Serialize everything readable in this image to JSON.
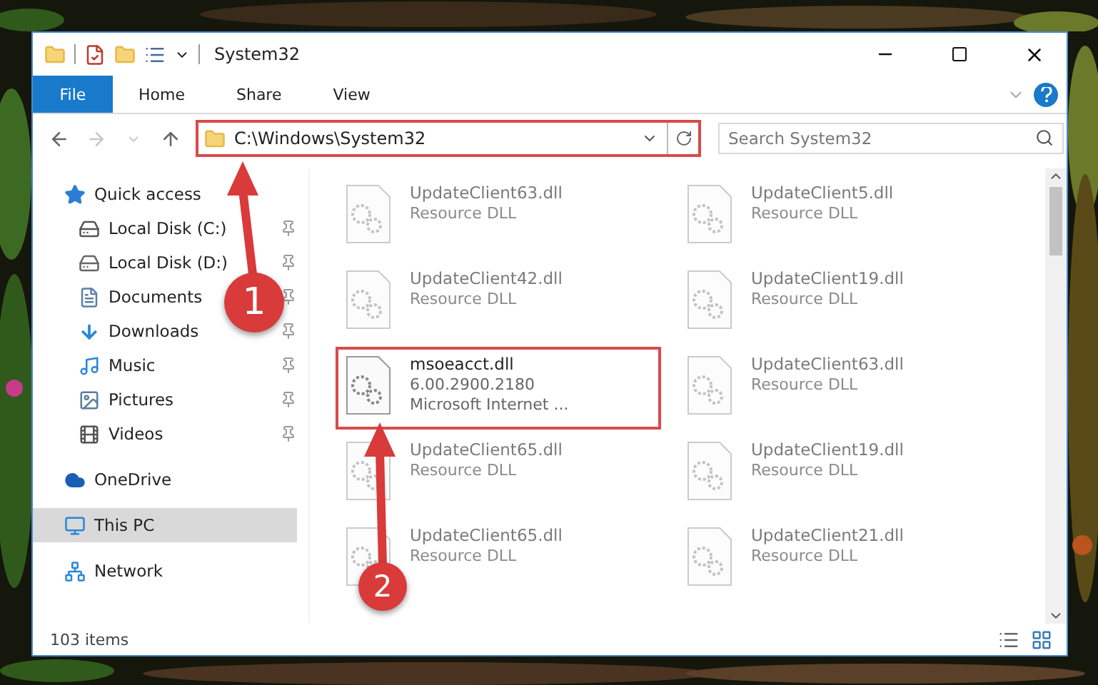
{
  "window": {
    "title": "System32"
  },
  "ribbon_tabs": [
    {
      "label": "File",
      "selected": true
    },
    {
      "label": "Home",
      "selected": false
    },
    {
      "label": "Share",
      "selected": false
    },
    {
      "label": "View",
      "selected": false
    }
  ],
  "address_bar": {
    "value": "C:\\Windows\\System32",
    "highlighted": true
  },
  "search": {
    "placeholder": "Search System32"
  },
  "sidebar": {
    "items": [
      {
        "label": "Quick access",
        "kind": "star",
        "selected": false,
        "children": [
          {
            "label": "Local Disk (C:)",
            "kind": "disk-c",
            "pinned": true,
            "selected": false
          },
          {
            "label": "Local Disk (D:)",
            "kind": "disk",
            "pinned": true,
            "selected": false
          },
          {
            "label": "Documents",
            "kind": "documents",
            "pinned": true,
            "selected": false
          },
          {
            "label": "Downloads",
            "kind": "downloads",
            "pinned": true,
            "selected": false
          },
          {
            "label": "Music",
            "kind": "music",
            "pinned": true,
            "selected": false
          },
          {
            "label": "Pictures",
            "kind": "pictures",
            "pinned": true,
            "selected": false
          },
          {
            "label": "Videos",
            "kind": "videos",
            "pinned": true,
            "selected": false
          }
        ]
      },
      {
        "label": "OneDrive",
        "kind": "cloud",
        "selected": false
      },
      {
        "label": "This PC",
        "kind": "pc",
        "selected": true
      },
      {
        "label": "Network",
        "kind": "network",
        "selected": false
      }
    ]
  },
  "files": [
    {
      "name": "UpdateClient63.dll",
      "lines": [
        "Resource DLL"
      ],
      "faded": true,
      "highlighted": false
    },
    {
      "name": "UpdateClient5.dll",
      "lines": [
        "Resource DLL"
      ],
      "faded": true,
      "highlighted": false
    },
    {
      "name": "UpdateClient42.dll",
      "lines": [
        "Resource DLL"
      ],
      "faded": true,
      "highlighted": false
    },
    {
      "name": "UpdateClient19.dll",
      "lines": [
        "Resource DLL"
      ],
      "faded": true,
      "highlighted": false
    },
    {
      "name": "msoeacct.dll",
      "lines": [
        "6.00.2900.2180",
        "Microsoft Internet ..."
      ],
      "faded": false,
      "highlighted": true
    },
    {
      "name": "UpdateClient63.dll",
      "lines": [
        "Resource DLL"
      ],
      "faded": true,
      "highlighted": false
    },
    {
      "name": "UpdateClient65.dll",
      "lines": [
        "Resource DLL"
      ],
      "faded": true,
      "highlighted": false
    },
    {
      "name": "UpdateClient19.dll",
      "lines": [
        "Resource DLL"
      ],
      "faded": true,
      "highlighted": false
    },
    {
      "name": "UpdateClient65.dll",
      "lines": [
        "Resource DLL"
      ],
      "faded": true,
      "highlighted": false
    },
    {
      "name": "UpdateClient21.dll",
      "lines": [
        "Resource DLL"
      ],
      "faded": true,
      "highlighted": false
    }
  ],
  "status_bar": {
    "item_count": "103 items"
  },
  "annotations": [
    {
      "label": "1"
    },
    {
      "label": "2"
    }
  ]
}
